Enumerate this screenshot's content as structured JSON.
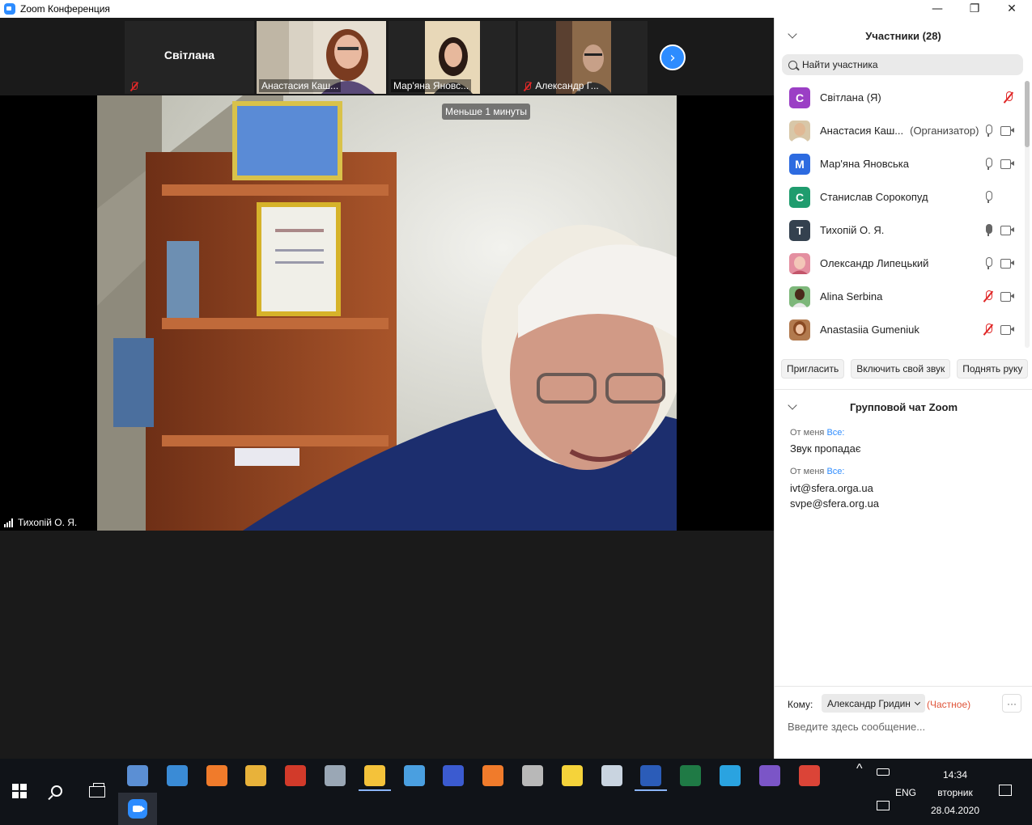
{
  "window": {
    "title": "Zoom Конференция",
    "minimize": "—",
    "maximize": "❐",
    "close": "✕"
  },
  "strip": {
    "tiles": [
      {
        "name": "Світлана",
        "mic_muted": true
      },
      {
        "name": "Анастасия Каш...",
        "mic_muted": false
      },
      {
        "name": "Мар'яна Яновс...",
        "mic_muted": false
      },
      {
        "name": "Александр Г...",
        "mic_muted": true
      }
    ],
    "next_icon": "›"
  },
  "main": {
    "timer": "Меньше 1 минуты",
    "speaker": "Тихопій О. Я."
  },
  "participants": {
    "title": "Участники (28)",
    "search_placeholder": "Найти участника",
    "list": [
      {
        "name": "Світлана (Я)",
        "initial": "С",
        "color": "#9b3fc5",
        "role": "",
        "mic": "off",
        "video": false
      },
      {
        "name": "Анастасия Каш...",
        "initial": "",
        "color": "#d8c7a8",
        "role": "(Организатор)",
        "mic": "on",
        "video": true
      },
      {
        "name": "Мар'яна Яновська",
        "initial": "М",
        "color": "#2d6be0",
        "role": "",
        "mic": "on",
        "video": true
      },
      {
        "name": "Станислав Сорокопуд",
        "initial": "С",
        "color": "#1f9c6e",
        "role": "",
        "mic": "on",
        "video": false
      },
      {
        "name": "Тихопій О. Я.",
        "initial": "Т",
        "color": "#34414f",
        "role": "",
        "mic": "active",
        "video": true
      },
      {
        "name": "Олександр Липецький",
        "initial": "",
        "color": "#e48fa0",
        "role": "",
        "mic": "on",
        "video": true
      },
      {
        "name": "Alina Serbina",
        "initial": "",
        "color": "#7db77a",
        "role": "",
        "mic": "off",
        "video": true
      },
      {
        "name": "Anastasiia Gumeniuk",
        "initial": "",
        "color": "#b27a4e",
        "role": "",
        "mic": "off",
        "video": true
      }
    ],
    "buttons": {
      "invite": "Пригласить",
      "unmute": "Включить свой звук",
      "raise_hand": "Поднять руку"
    }
  },
  "chat": {
    "title": "Групповой чат Zoom",
    "messages": [
      {
        "from": "От меня",
        "to": "Все:",
        "lines": [
          "Звук пропадає"
        ]
      },
      {
        "from": "От меня",
        "to": "Все:",
        "lines": [
          "ivt@sfera.orga.ua",
          "svpe@sfera.org.ua"
        ]
      }
    ],
    "to_label": "Кому:",
    "recipient": "Александр Гридин",
    "private_label": "(Частное)",
    "more": "···",
    "input_placeholder": "Введите здесь сообщение..."
  },
  "taskbar": {
    "time": "14:34",
    "day": "вторник",
    "date": "28.04.2020",
    "lang": "ENG",
    "tray_chevron": "^",
    "apps": [
      {
        "icon": "calculator-icon",
        "color": "#5b8fd4"
      },
      {
        "icon": "network-globe-icon",
        "color": "#3a8bd6"
      },
      {
        "icon": "camera-app-icon",
        "color": "#f07b2b"
      },
      {
        "icon": "contacts-app-icon",
        "color": "#e8b23a"
      },
      {
        "icon": "pdf-viewer-icon",
        "color": "#d23a2a"
      },
      {
        "icon": "image-viewer-icon",
        "color": "#9aa7b5"
      },
      {
        "icon": "file-explorer-icon",
        "color": "#f4c23a"
      },
      {
        "icon": "control-panel-icon",
        "color": "#4a9fe0"
      },
      {
        "icon": "save-disk-icon",
        "color": "#3b5bd0"
      },
      {
        "icon": "camera-app-2-icon",
        "color": "#f07b2b"
      },
      {
        "icon": "usb-tool-icon",
        "color": "#b8b8b8"
      },
      {
        "icon": "lightning-app-icon",
        "color": "#f5d33a"
      },
      {
        "icon": "paint-app-icon",
        "color": "#c9d4e0"
      },
      {
        "icon": "word-icon",
        "color": "#2b5cb8"
      },
      {
        "icon": "excel-icon",
        "color": "#1f7a45"
      },
      {
        "icon": "telegram-icon",
        "color": "#2aa3e0"
      },
      {
        "icon": "viber-icon",
        "color": "#7b55c7"
      },
      {
        "icon": "chrome-icon",
        "color": "#db4437"
      }
    ]
  }
}
